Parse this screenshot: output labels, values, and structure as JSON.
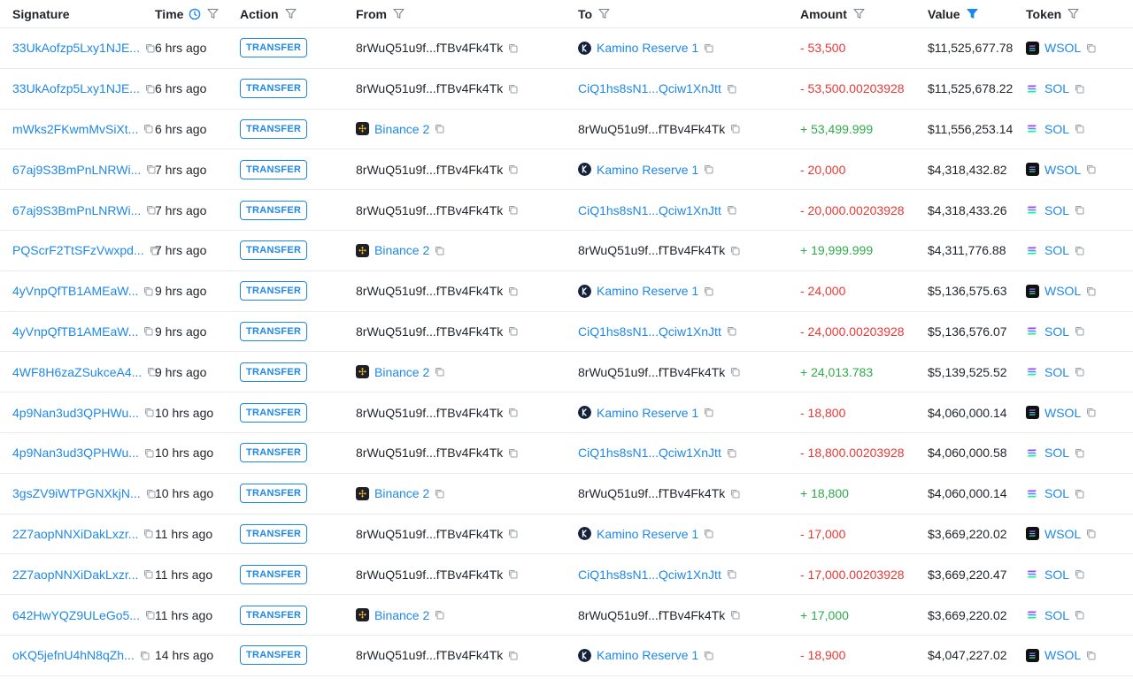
{
  "headers": {
    "signature": "Signature",
    "time": "Time",
    "action": "Action",
    "from": "From",
    "to": "To",
    "amount": "Amount",
    "value": "Value",
    "token": "Token"
  },
  "colors": {
    "link": "#1e88e5",
    "negative": "#e53935",
    "positive": "#2eaa4a",
    "active_filter": "#1e88e5"
  },
  "icons": {
    "filter": "filter-icon",
    "clock": "clock-icon",
    "copy": "copy-icon",
    "kamino": "kamino-icon",
    "binance": "binance-icon",
    "sol": "sol-icon",
    "wsol": "wsol-icon"
  },
  "rows": [
    {
      "signature": "33UkAofzp5Lxy1NJE...",
      "time": "6 hrs ago",
      "action": "TRANSFER",
      "from": "8rWuQ51u9f...fTBv4Fk4Tk",
      "from_type": "addr",
      "to": "Kamino Reserve 1",
      "to_type": "kamino",
      "amount": "- 53,500",
      "sign": "neg",
      "value": "$11,525,677.78",
      "token": "WSOL",
      "token_type": "wsol"
    },
    {
      "signature": "33UkAofzp5Lxy1NJE...",
      "time": "6 hrs ago",
      "action": "TRANSFER",
      "from": "8rWuQ51u9f...fTBv4Fk4Tk",
      "from_type": "addr",
      "to": "CiQ1hs8sN1...Qciw1XnJtt",
      "to_type": "link",
      "amount": "- 53,500.00203928",
      "sign": "neg",
      "value": "$11,525,678.22",
      "token": "SOL",
      "token_type": "sol"
    },
    {
      "signature": "mWks2FKwmMvSiXt...",
      "time": "6 hrs ago",
      "action": "TRANSFER",
      "from": "Binance 2",
      "from_type": "binance",
      "to": "8rWuQ51u9f...fTBv4Fk4Tk",
      "to_type": "addr",
      "amount": "+ 53,499.999",
      "sign": "pos",
      "value": "$11,556,253.14",
      "token": "SOL",
      "token_type": "sol"
    },
    {
      "signature": "67aj9S3BmPnLNRWi...",
      "time": "7 hrs ago",
      "action": "TRANSFER",
      "from": "8rWuQ51u9f...fTBv4Fk4Tk",
      "from_type": "addr",
      "to": "Kamino Reserve 1",
      "to_type": "kamino",
      "amount": "- 20,000",
      "sign": "neg",
      "value": "$4,318,432.82",
      "token": "WSOL",
      "token_type": "wsol"
    },
    {
      "signature": "67aj9S3BmPnLNRWi...",
      "time": "7 hrs ago",
      "action": "TRANSFER",
      "from": "8rWuQ51u9f...fTBv4Fk4Tk",
      "from_type": "addr",
      "to": "CiQ1hs8sN1...Qciw1XnJtt",
      "to_type": "link",
      "amount": "- 20,000.00203928",
      "sign": "neg",
      "value": "$4,318,433.26",
      "token": "SOL",
      "token_type": "sol"
    },
    {
      "signature": "PQScrF2TtSFzVwxpd...",
      "time": "7 hrs ago",
      "action": "TRANSFER",
      "from": "Binance 2",
      "from_type": "binance",
      "to": "8rWuQ51u9f...fTBv4Fk4Tk",
      "to_type": "addr",
      "amount": "+ 19,999.999",
      "sign": "pos",
      "value": "$4,311,776.88",
      "token": "SOL",
      "token_type": "sol"
    },
    {
      "signature": "4yVnpQfTB1AMEaW...",
      "time": "9 hrs ago",
      "action": "TRANSFER",
      "from": "8rWuQ51u9f...fTBv4Fk4Tk",
      "from_type": "addr",
      "to": "Kamino Reserve 1",
      "to_type": "kamino",
      "amount": "- 24,000",
      "sign": "neg",
      "value": "$5,136,575.63",
      "token": "WSOL",
      "token_type": "wsol"
    },
    {
      "signature": "4yVnpQfTB1AMEaW...",
      "time": "9 hrs ago",
      "action": "TRANSFER",
      "from": "8rWuQ51u9f...fTBv4Fk4Tk",
      "from_type": "addr",
      "to": "CiQ1hs8sN1...Qciw1XnJtt",
      "to_type": "link",
      "amount": "- 24,000.00203928",
      "sign": "neg",
      "value": "$5,136,576.07",
      "token": "SOL",
      "token_type": "sol"
    },
    {
      "signature": "4WF8H6zaZSukceA4...",
      "time": "9 hrs ago",
      "action": "TRANSFER",
      "from": "Binance 2",
      "from_type": "binance",
      "to": "8rWuQ51u9f...fTBv4Fk4Tk",
      "to_type": "addr",
      "amount": "+ 24,013.783",
      "sign": "pos",
      "value": "$5,139,525.52",
      "token": "SOL",
      "token_type": "sol"
    },
    {
      "signature": "4p9Nan3ud3QPHWu...",
      "time": "10 hrs ago",
      "action": "TRANSFER",
      "from": "8rWuQ51u9f...fTBv4Fk4Tk",
      "from_type": "addr",
      "to": "Kamino Reserve 1",
      "to_type": "kamino",
      "amount": "- 18,800",
      "sign": "neg",
      "value": "$4,060,000.14",
      "token": "WSOL",
      "token_type": "wsol"
    },
    {
      "signature": "4p9Nan3ud3QPHWu...",
      "time": "10 hrs ago",
      "action": "TRANSFER",
      "from": "8rWuQ51u9f...fTBv4Fk4Tk",
      "from_type": "addr",
      "to": "CiQ1hs8sN1...Qciw1XnJtt",
      "to_type": "link",
      "amount": "- 18,800.00203928",
      "sign": "neg",
      "value": "$4,060,000.58",
      "token": "SOL",
      "token_type": "sol"
    },
    {
      "signature": "3gsZV9iWTPGNXkjN...",
      "time": "10 hrs ago",
      "action": "TRANSFER",
      "from": "Binance 2",
      "from_type": "binance",
      "to": "8rWuQ51u9f...fTBv4Fk4Tk",
      "to_type": "addr",
      "amount": "+ 18,800",
      "sign": "pos",
      "value": "$4,060,000.14",
      "token": "SOL",
      "token_type": "sol"
    },
    {
      "signature": "2Z7aopNNXiDakLxzr...",
      "time": "11 hrs ago",
      "action": "TRANSFER",
      "from": "8rWuQ51u9f...fTBv4Fk4Tk",
      "from_type": "addr",
      "to": "Kamino Reserve 1",
      "to_type": "kamino",
      "amount": "- 17,000",
      "sign": "neg",
      "value": "$3,669,220.02",
      "token": "WSOL",
      "token_type": "wsol"
    },
    {
      "signature": "2Z7aopNNXiDakLxzr...",
      "time": "11 hrs ago",
      "action": "TRANSFER",
      "from": "8rWuQ51u9f...fTBv4Fk4Tk",
      "from_type": "addr",
      "to": "CiQ1hs8sN1...Qciw1XnJtt",
      "to_type": "link",
      "amount": "- 17,000.00203928",
      "sign": "neg",
      "value": "$3,669,220.47",
      "token": "SOL",
      "token_type": "sol"
    },
    {
      "signature": "642HwYQZ9ULeGo5...",
      "time": "11 hrs ago",
      "action": "TRANSFER",
      "from": "Binance 2",
      "from_type": "binance",
      "to": "8rWuQ51u9f...fTBv4Fk4Tk",
      "to_type": "addr",
      "amount": "+ 17,000",
      "sign": "pos",
      "value": "$3,669,220.02",
      "token": "SOL",
      "token_type": "sol"
    },
    {
      "signature": "oKQ5jefnU4hN8qZh...",
      "time": "14 hrs ago",
      "action": "TRANSFER",
      "from": "8rWuQ51u9f...fTBv4Fk4Tk",
      "from_type": "addr",
      "to": "Kamino Reserve 1",
      "to_type": "kamino",
      "amount": "- 18,900",
      "sign": "neg",
      "value": "$4,047,227.02",
      "token": "WSOL",
      "token_type": "wsol"
    }
  ]
}
